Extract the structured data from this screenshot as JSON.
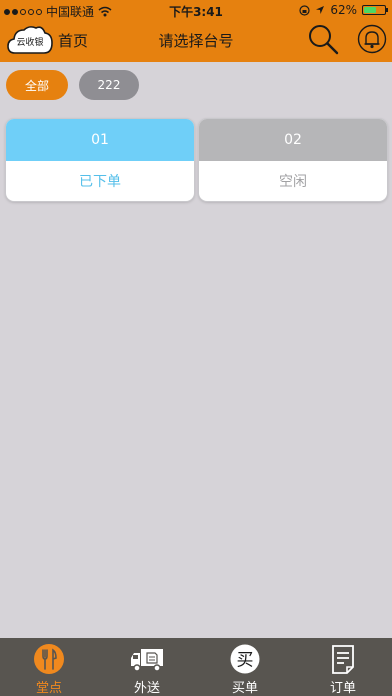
{
  "status_bar": {
    "carrier": "中国联通",
    "time": "下午3:41",
    "battery": "62%",
    "battery_level": 0.62
  },
  "header": {
    "logo_text": "云收银",
    "home_label": "首页",
    "title": "请选择台号",
    "search_icon": "search-icon",
    "bell_icon": "bell-icon"
  },
  "filters": [
    {
      "label": "全部",
      "active": true
    },
    {
      "label": "222",
      "active": false
    }
  ],
  "tables": [
    {
      "number": "01",
      "status": "已下单"
    },
    {
      "number": "02",
      "status": "空闲"
    }
  ],
  "tabs": [
    {
      "label": "堂点",
      "icon": "dine-in-icon",
      "active": true
    },
    {
      "label": "外送",
      "icon": "delivery-truck-icon",
      "active": false
    },
    {
      "label": "买单",
      "icon": "checkout-icon",
      "active": false,
      "icon_text": "买"
    },
    {
      "label": "订单",
      "icon": "order-list-icon",
      "active": false
    }
  ],
  "colors": {
    "accent": "#e6810f",
    "ordered_table": "#6fcff8",
    "idle_table": "#b6b6b8",
    "tabbar": "#585550"
  }
}
